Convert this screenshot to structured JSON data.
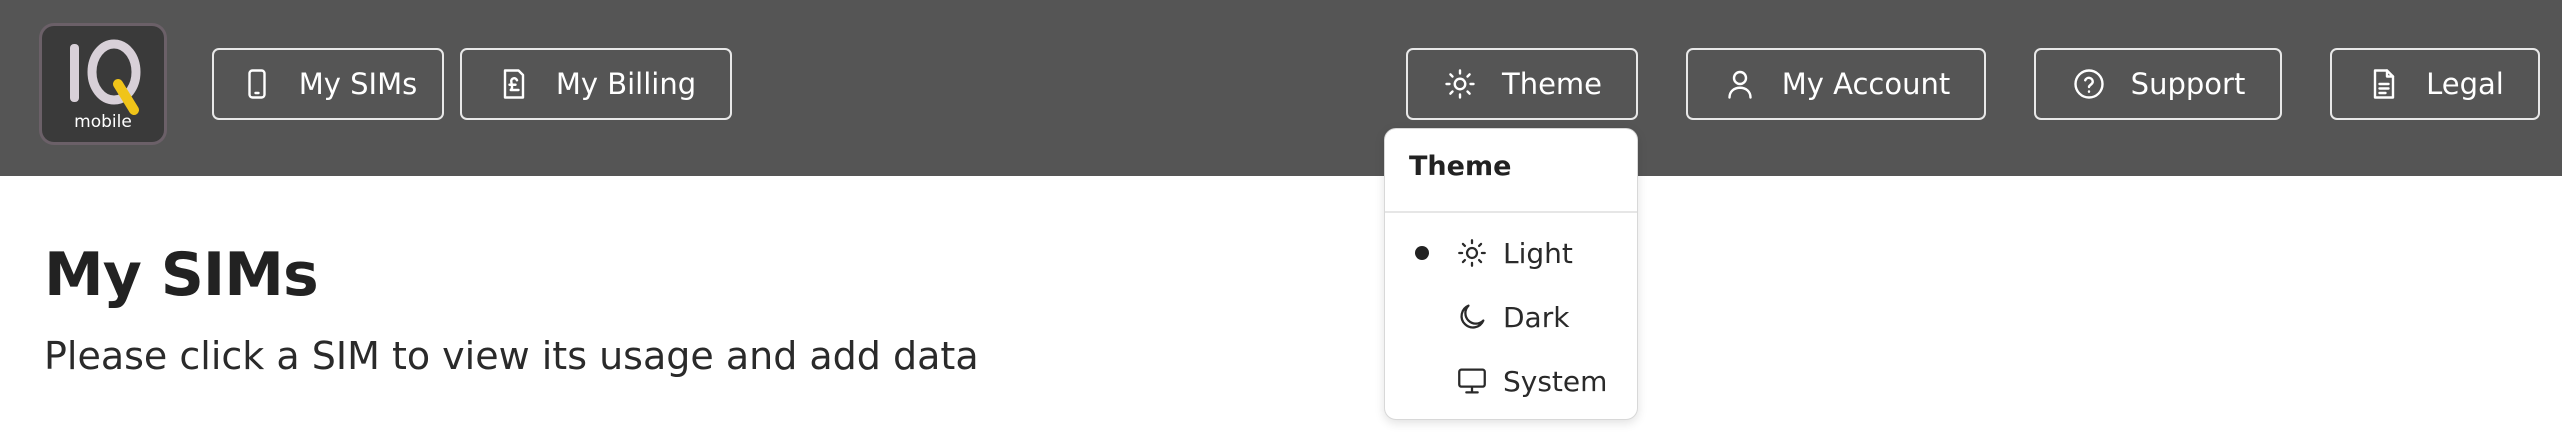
{
  "logo": {
    "text": "mobile"
  },
  "nav_left": [
    {
      "label": "My SIMs",
      "icon": "phone-icon"
    },
    {
      "label": "My Billing",
      "icon": "billing-icon"
    }
  ],
  "nav_right": [
    {
      "label": "Theme",
      "icon": "sun-icon"
    },
    {
      "label": "My Account",
      "icon": "user-icon"
    },
    {
      "label": "Support",
      "icon": "help-icon"
    },
    {
      "label": "Legal",
      "icon": "document-icon"
    }
  ],
  "page": {
    "title": "My SIMs",
    "subtitle": "Please click a SIM to view its usage and add data"
  },
  "theme_menu": {
    "header": "Theme",
    "options": [
      {
        "label": "Light",
        "icon": "sun-icon",
        "selected": true
      },
      {
        "label": "Dark",
        "icon": "moon-icon",
        "selected": false
      },
      {
        "label": "System",
        "icon": "monitor-icon",
        "selected": false
      }
    ]
  },
  "colors": {
    "topbar": "#555555",
    "logo_accent": "#f0c419",
    "background": "#ffffff"
  }
}
